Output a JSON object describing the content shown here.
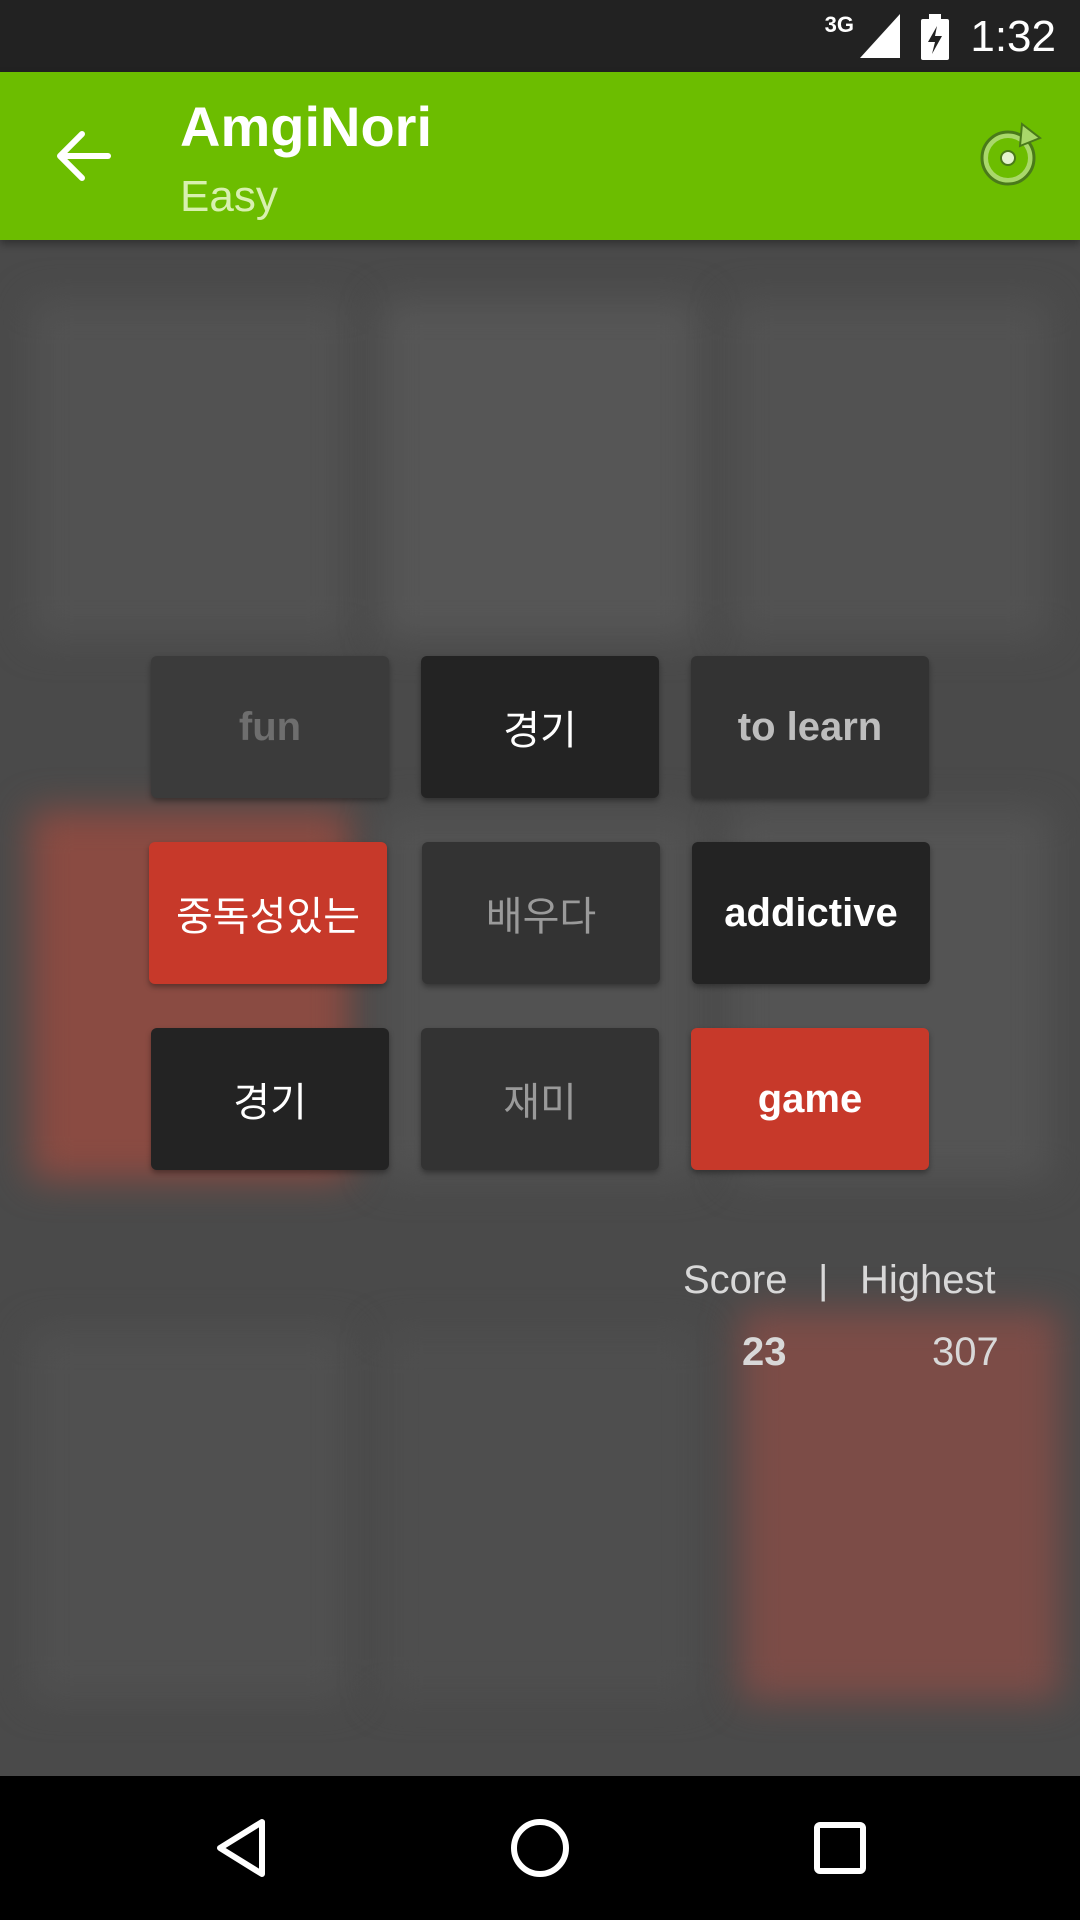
{
  "status_bar": {
    "network": "3G",
    "time": "1:32",
    "icons": [
      "signal-icon",
      "battery-charging-icon"
    ]
  },
  "app_bar": {
    "title": "AmgiNori",
    "subtitle": "Easy",
    "back_icon": "arrow-back-icon",
    "refresh_icon": "refresh-icon",
    "color": "#6cbd00"
  },
  "grid": {
    "tiles": [
      {
        "label": "fun",
        "style": "dim"
      },
      {
        "label": "경기",
        "style": "dark"
      },
      {
        "label": "to learn",
        "style": "mid"
      },
      {
        "label": "중독성있는",
        "style": "red"
      },
      {
        "label": "배우다",
        "style": "mid-k"
      },
      {
        "label": "addictive",
        "style": "dark-bold"
      },
      {
        "label": "경기",
        "style": "dark"
      },
      {
        "label": "재미",
        "style": "mid-k"
      },
      {
        "label": "game",
        "style": "red-bold"
      }
    ]
  },
  "score": {
    "score_label": "Score",
    "separator": "|",
    "highest_label": "Highest",
    "score_value": "23",
    "highest_value": "307"
  },
  "colors": {
    "accent_green": "#6cbd00",
    "tile_red": "#c7392a",
    "tile_dark": "#232323",
    "background": "#4a4a4a"
  }
}
